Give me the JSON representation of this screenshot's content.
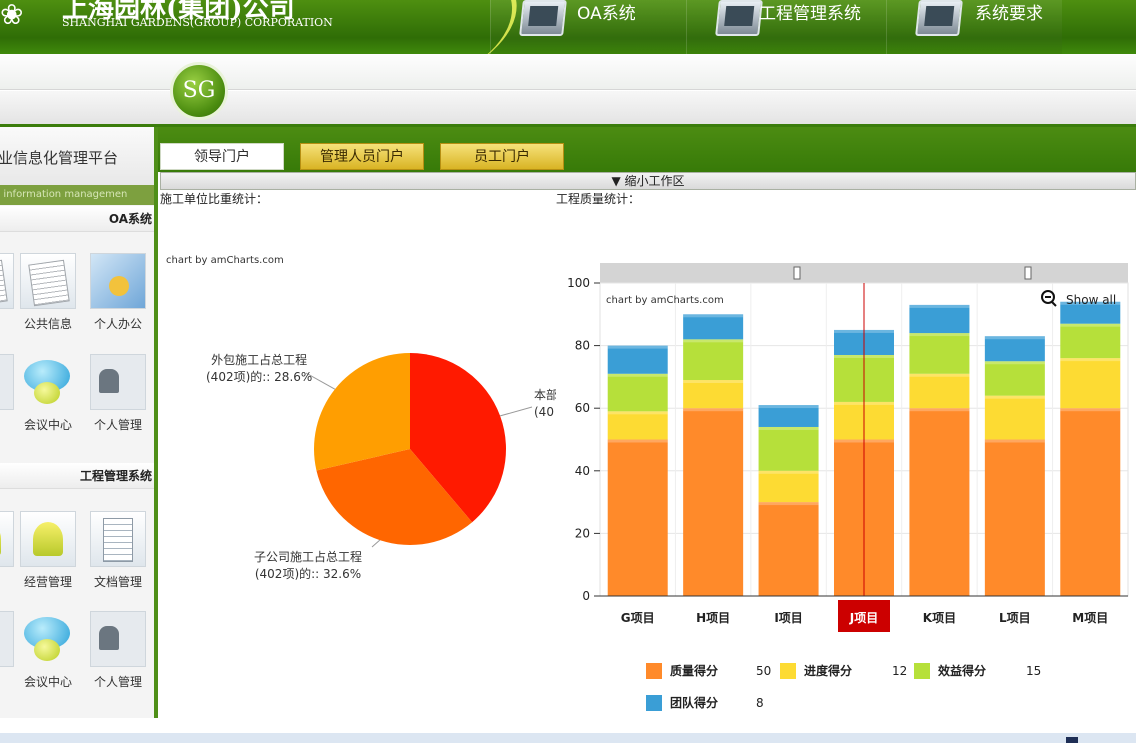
{
  "header": {
    "company_cn": "上海园林(集团)公司",
    "company_en": "SHANGHAI GARDENS(GROUP) CORPORATION",
    "nav": [
      {
        "label": "OA系统",
        "icon": "monitor-icon"
      },
      {
        "label": "工程管理系统",
        "icon": "tools-monitor-icon"
      },
      {
        "label": "系统要求",
        "icon": "monitor-icon"
      }
    ],
    "badge": "SG"
  },
  "sidebar": {
    "title_cn": "业信息化管理平台",
    "title_en": "rise information managemen",
    "sections": [
      {
        "name": "OA系统",
        "tiles": [
          {
            "label": "公共信息",
            "icon": "document-pen-icon"
          },
          {
            "label": "个人办公",
            "icon": "folder-icon"
          },
          {
            "label": "会议中心",
            "icon": "chat-bubbles-icon"
          },
          {
            "label": "个人管理",
            "icon": "id-card-icon"
          }
        ]
      },
      {
        "name": "工程管理系统",
        "tiles": [
          {
            "label": "经营管理",
            "icon": "desk-lamp-icon"
          },
          {
            "label": "文档管理",
            "icon": "clipboard-icon"
          },
          {
            "label": "会议中心",
            "icon": "chat-bubbles-icon"
          },
          {
            "label": "个人管理",
            "icon": "id-card-icon"
          }
        ]
      }
    ]
  },
  "tabs": [
    {
      "label": "领导门户",
      "active": true
    },
    {
      "label": "管理人员门户",
      "active": false
    },
    {
      "label": "员工门户",
      "active": false
    }
  ],
  "shrink_label": "▼ 缩小工作区",
  "left_panel": {
    "title": "施工单位比重统计：",
    "credit": "chart by amCharts.com"
  },
  "right_panel": {
    "title": "工程质量统计：",
    "credit": "chart by amCharts.com",
    "show_all": "Show all"
  },
  "chart_data": [
    {
      "type": "pie",
      "slices": [
        {
          "label": "本部",
          "sublabel": "(40",
          "value": 38.8,
          "color": "#ff1a00"
        },
        {
          "label": "子公司施工占总工程",
          "sublabel": "(402项)的:: 32.6%",
          "value": 32.6,
          "color": "#ff6600"
        },
        {
          "label": "外包施工占总工程",
          "sublabel": "(402项)的:: 28.6%",
          "value": 28.6,
          "color": "#ff9e01"
        }
      ]
    },
    {
      "type": "bar",
      "stacked": true,
      "categories": [
        "G项目",
        "H项目",
        "I项目",
        "J项目",
        "K项目",
        "L项目",
        "M项目"
      ],
      "highlight_category": "J项目",
      "ylim": [
        0,
        100
      ],
      "yticks": [
        0,
        20,
        40,
        60,
        80,
        100
      ],
      "series": [
        {
          "name": "质量得分",
          "color": "#ff8a2a",
          "values": [
            50,
            60,
            30,
            50,
            60,
            50,
            60
          ]
        },
        {
          "name": "进度得分",
          "color": "#fddb33",
          "values": [
            9,
            9,
            10,
            12,
            11,
            14,
            16
          ]
        },
        {
          "name": "效益得分",
          "color": "#b6e03a",
          "values": [
            12,
            13,
            14,
            15,
            13,
            11,
            11
          ]
        },
        {
          "name": "团队得分",
          "color": "#3a9ed6",
          "values": [
            9,
            8,
            7,
            8,
            9,
            8,
            7
          ]
        }
      ],
      "legend": [
        {
          "name": "质量得分",
          "value": "50"
        },
        {
          "name": "进度得分",
          "value": "12"
        },
        {
          "name": "效益得分",
          "value": "15"
        },
        {
          "name": "团队得分",
          "value": "8"
        }
      ]
    }
  ]
}
